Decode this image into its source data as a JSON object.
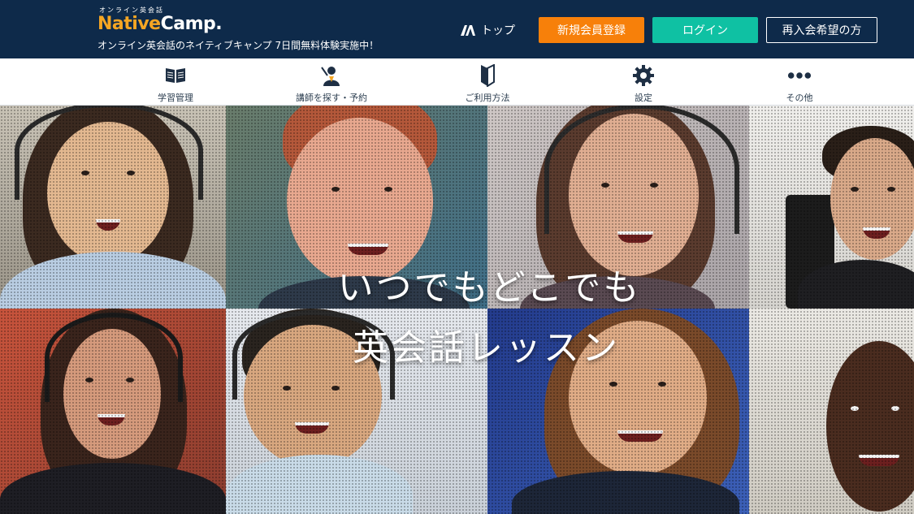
{
  "header": {
    "logo_small": "オンライン英会話",
    "logo_native": "Native",
    "logo_camp": "Camp.",
    "tagline": "オンライン英会話のネイティブキャンプ 7日間無料体験実施中！",
    "nav_top_label": "トップ",
    "register_label": "新規会員登録",
    "login_label": "ログイン",
    "rejoin_label": "再入会希望の方"
  },
  "menu": {
    "items": [
      {
        "label": "学習管理",
        "icon": "book-icon"
      },
      {
        "label": "講師を探す・予約",
        "icon": "teacher-icon"
      },
      {
        "label": "ご利用方法",
        "icon": "beginner-mark-icon"
      },
      {
        "label": "設定",
        "icon": "gear-icon"
      },
      {
        "label": "その他",
        "icon": "more-dots-icon"
      }
    ]
  },
  "hero": {
    "line1": "いつでもどこでも",
    "line2": "英会話レッスン"
  },
  "colors": {
    "header_bg": "#0e2a4a",
    "logo_accent": "#f5a623",
    "register_bg": "#f7800a",
    "login_bg": "#0fc1a3"
  }
}
